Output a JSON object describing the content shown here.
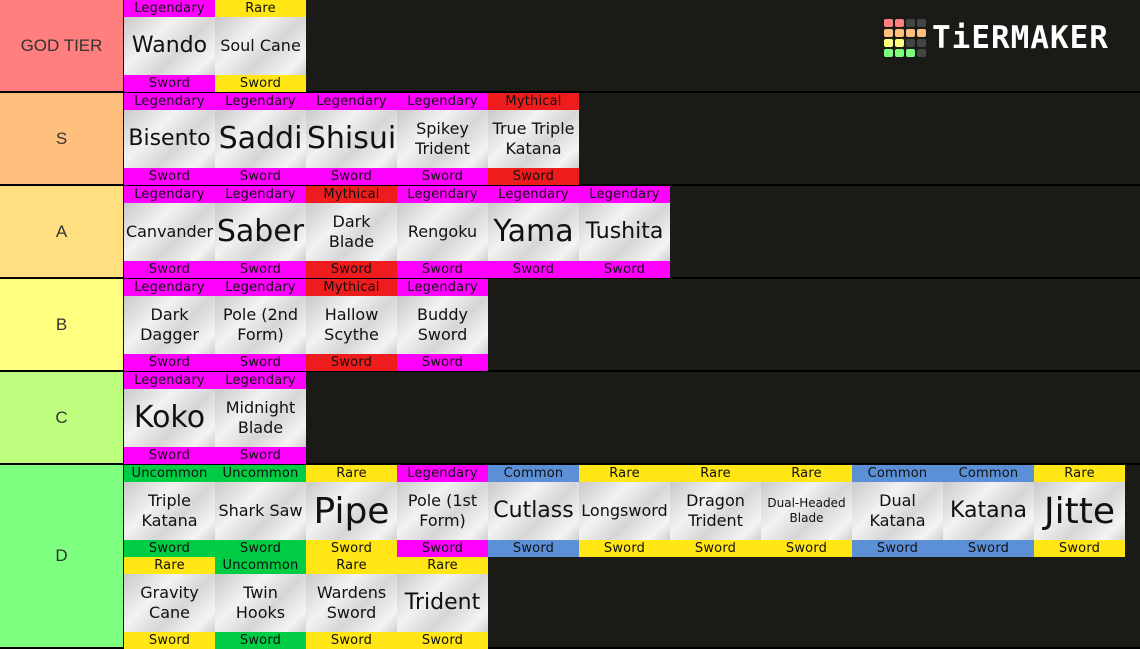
{
  "brand": {
    "name": "TiERMAKER",
    "grid_colors": [
      "#ff7f7f",
      "#ff7f7f",
      "#444444",
      "#444444",
      "#ffbf7f",
      "#ffbf7f",
      "#ffbf7f",
      "#ffbf7f",
      "#ffff7f",
      "#ffff7f",
      "#444444",
      "#444444",
      "#7fff7f",
      "#7fff7f",
      "#7fff7f",
      "#444444"
    ]
  },
  "rarity_colors": {
    "Legendary": "#ff00ff",
    "Mythical": "#ee1c1c",
    "Rare": "#ffe614",
    "Uncommon": "#00cc44",
    "Common": "#5b8fd6"
  },
  "tiers": [
    {
      "label": "GOD TIER",
      "color": "#ff7f7f",
      "items": [
        {
          "name": "Wando",
          "rarity": "Legendary",
          "type": "Sword",
          "size": "l"
        },
        {
          "name": "Soul Cane",
          "rarity": "Rare",
          "type": "Sword",
          "size": "m"
        }
      ]
    },
    {
      "label": "S",
      "color": "#ffbf7f",
      "items": [
        {
          "name": "Bisento",
          "rarity": "Legendary",
          "type": "Sword",
          "size": "l"
        },
        {
          "name": "Saddi",
          "rarity": "Legendary",
          "type": "Sword",
          "size": "xl"
        },
        {
          "name": "Shisui",
          "rarity": "Legendary",
          "type": "Sword",
          "size": "xl"
        },
        {
          "name": "Spikey Trident",
          "rarity": "Legendary",
          "type": "Sword",
          "size": "m"
        },
        {
          "name": "True Triple Katana",
          "rarity": "Mythical",
          "type": "Sword",
          "size": "m"
        }
      ]
    },
    {
      "label": "A",
      "color": "#ffdf7f",
      "items": [
        {
          "name": "Canvander",
          "rarity": "Legendary",
          "type": "Sword",
          "size": "m"
        },
        {
          "name": "Saber",
          "rarity": "Legendary",
          "type": "Sword",
          "size": "xl"
        },
        {
          "name": "Dark Blade",
          "rarity": "Mythical",
          "type": "Sword",
          "size": "m"
        },
        {
          "name": "Rengoku",
          "rarity": "Legendary",
          "type": "Sword",
          "size": "m"
        },
        {
          "name": "Yama",
          "rarity": "Legendary",
          "type": "Sword",
          "size": "xl"
        },
        {
          "name": "Tushita",
          "rarity": "Legendary",
          "type": "Sword",
          "size": "l"
        }
      ]
    },
    {
      "label": "B",
      "color": "#ffff7f",
      "items": [
        {
          "name": "Dark Dagger",
          "rarity": "Legendary",
          "type": "Sword",
          "size": "m"
        },
        {
          "name": "Pole (2nd Form)",
          "rarity": "Legendary",
          "type": "Sword",
          "size": "m"
        },
        {
          "name": "Hallow Scythe",
          "rarity": "Mythical",
          "type": "Sword",
          "size": "m"
        },
        {
          "name": "Buddy Sword",
          "rarity": "Legendary",
          "type": "Sword",
          "size": "m"
        }
      ]
    },
    {
      "label": "C",
      "color": "#bfff7f",
      "items": [
        {
          "name": "Koko",
          "rarity": "Legendary",
          "type": "Sword",
          "size": "xl"
        },
        {
          "name": "Midnight Blade",
          "rarity": "Legendary",
          "type": "Sword",
          "size": "m"
        }
      ]
    },
    {
      "label": "D",
      "color": "#7fff7f",
      "items": [
        {
          "name": "Triple Katana",
          "rarity": "Uncommon",
          "type": "Sword",
          "size": "m"
        },
        {
          "name": "Shark Saw",
          "rarity": "Uncommon",
          "type": "Sword",
          "size": "m"
        },
        {
          "name": "Pipe",
          "rarity": "Rare",
          "type": "Sword",
          "size": "xxl"
        },
        {
          "name": "Pole (1st Form)",
          "rarity": "Legendary",
          "type": "Sword",
          "size": "m"
        },
        {
          "name": "Cutlass",
          "rarity": "Common",
          "type": "Sword",
          "size": "l"
        },
        {
          "name": "Longsword",
          "rarity": "Rare",
          "type": "Sword",
          "size": "m"
        },
        {
          "name": "Dragon Trident",
          "rarity": "Rare",
          "type": "Sword",
          "size": "m"
        },
        {
          "name": "Dual-Headed Blade",
          "rarity": "Rare",
          "type": "Sword",
          "size": "s"
        },
        {
          "name": "Dual Katana",
          "rarity": "Common",
          "type": "Sword",
          "size": "m"
        },
        {
          "name": "Katana",
          "rarity": "Common",
          "type": "Sword",
          "size": "l"
        },
        {
          "name": "Jitte",
          "rarity": "Rare",
          "type": "Sword",
          "size": "xxl"
        },
        {
          "name": "Gravity Cane",
          "rarity": "Rare",
          "type": "Sword",
          "size": "m"
        },
        {
          "name": "Twin Hooks",
          "rarity": "Uncommon",
          "type": "Sword",
          "size": "m"
        },
        {
          "name": "Wardens Sword",
          "rarity": "Rare",
          "type": "Sword",
          "size": "m"
        },
        {
          "name": "Trident",
          "rarity": "Rare",
          "type": "Sword",
          "size": "l"
        }
      ]
    }
  ]
}
